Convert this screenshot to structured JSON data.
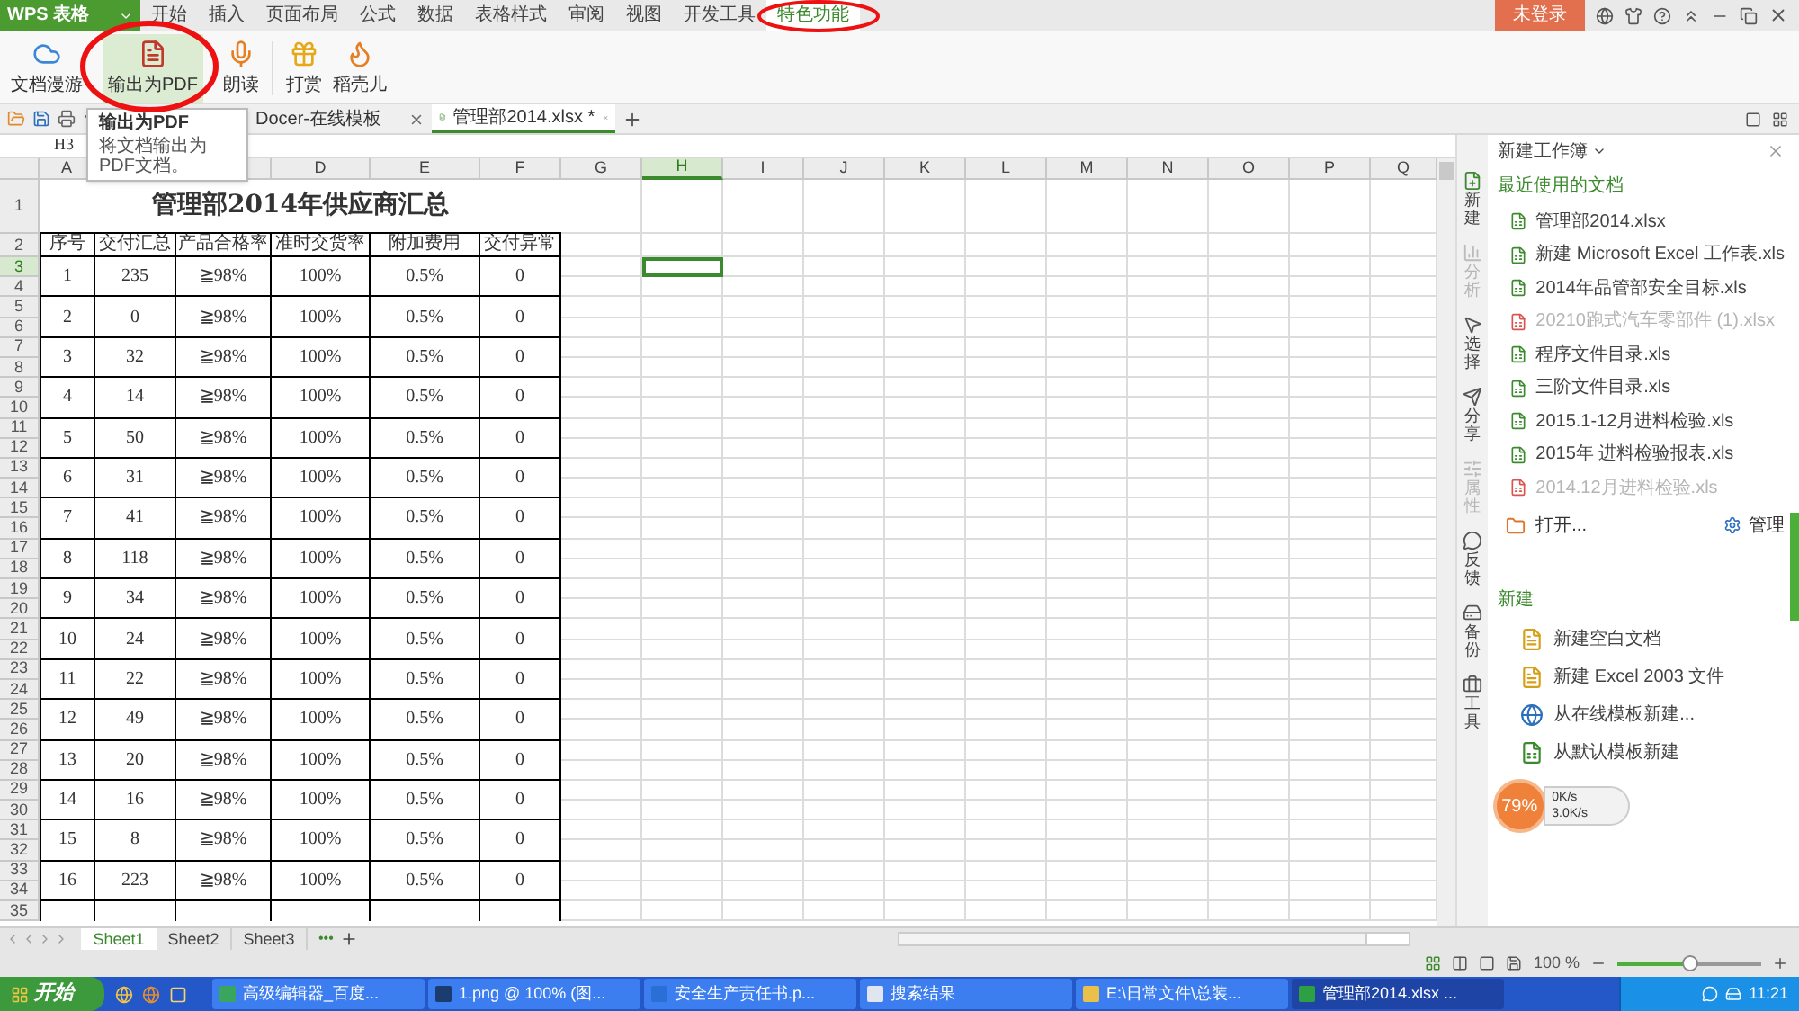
{
  "app_menu": {
    "label": "WPS 表格"
  },
  "menu_tabs": [
    {
      "label": "开始",
      "selected": false
    },
    {
      "label": "插入",
      "selected": false
    },
    {
      "label": "页面布局",
      "selected": false
    },
    {
      "label": "公式",
      "selected": false
    },
    {
      "label": "数据",
      "selected": false
    },
    {
      "label": "表格样式",
      "selected": false
    },
    {
      "label": "审阅",
      "selected": false
    },
    {
      "label": "视图",
      "selected": false
    },
    {
      "label": "开发工具",
      "selected": false
    },
    {
      "label": "特色功能",
      "selected": true
    }
  ],
  "account_button": "未登录",
  "ribbon_buttons": [
    {
      "label": "文档漫游",
      "kind": "cloud",
      "selected": false
    },
    {
      "label": "输出为PDF",
      "kind": "pdf",
      "selected": true
    },
    {
      "label": "朗读",
      "kind": "read",
      "selected": false
    },
    {
      "label": "打赏",
      "kind": "reward",
      "selected": false
    },
    {
      "label": "稻壳儿",
      "kind": "docer",
      "selected": false
    }
  ],
  "tooltip": {
    "title": "输出为PDF",
    "text": "将文档输出为PDF文档。"
  },
  "doc_tabs": [
    {
      "label": "Docer-在线模板",
      "selected": false
    },
    {
      "label": "管理部2014.xlsx *",
      "selected": true
    }
  ],
  "name_box": "H3",
  "columns": [
    {
      "label": "A",
      "selected": false
    },
    {},
    {},
    {
      "label": "D",
      "selected": false
    },
    {
      "label": "E",
      "selected": false
    },
    {
      "label": "F",
      "selected": false
    },
    {
      "label": "G",
      "selected": false
    },
    {
      "label": "H",
      "selected": true
    },
    {
      "label": "I",
      "selected": false
    },
    {
      "label": "J",
      "selected": false
    },
    {
      "label": "K",
      "selected": false
    },
    {
      "label": "L",
      "selected": false
    },
    {
      "label": "M",
      "selected": false
    },
    {
      "label": "N",
      "selected": false
    },
    {
      "label": "O",
      "selected": false
    },
    {
      "label": "P",
      "selected": false
    },
    {
      "label": "Q",
      "selected": false
    }
  ],
  "rows": [
    {
      "label": "1",
      "selected": false
    },
    {
      "label": "2",
      "selected": false
    },
    {
      "label": "3",
      "selected": true
    },
    {
      "label": "4",
      "selected": false
    },
    {
      "label": "5",
      "selected": false
    },
    {
      "label": "6",
      "selected": false
    },
    {
      "label": "7",
      "selected": false
    },
    {
      "label": "8",
      "selected": false
    },
    {
      "label": "9",
      "selected": false
    },
    {
      "label": "10",
      "selected": false
    },
    {
      "label": "11",
      "selected": false
    },
    {
      "label": "12",
      "selected": false
    },
    {
      "label": "13",
      "selected": false
    },
    {
      "label": "14",
      "selected": false
    },
    {
      "label": "15",
      "selected": false
    },
    {
      "label": "16",
      "selected": false
    },
    {
      "label": "17",
      "selected": false
    },
    {
      "label": "18",
      "selected": false
    },
    {
      "label": "19",
      "selected": false
    },
    {
      "label": "20",
      "selected": false
    },
    {
      "label": "21",
      "selected": false
    },
    {
      "label": "22",
      "selected": false
    },
    {
      "label": "23",
      "selected": false
    },
    {
      "label": "24",
      "selected": false
    },
    {
      "label": "25",
      "selected": false
    },
    {
      "label": "26",
      "selected": false
    },
    {
      "label": "27",
      "selected": false
    },
    {
      "label": "28",
      "selected": false
    },
    {
      "label": "29",
      "selected": false
    },
    {
      "label": "30",
      "selected": false
    },
    {
      "label": "31",
      "selected": false
    },
    {
      "label": "32",
      "selected": false
    },
    {
      "label": "33",
      "selected": false
    },
    {
      "label": "34",
      "selected": false
    },
    {
      "label": "35",
      "selected": false
    }
  ],
  "table": {
    "title": "管理部2014年供应商汇总",
    "columns": [
      "序号",
      "交付汇总",
      "产品合格率",
      "准时交货率",
      "附加费用",
      "交付异常"
    ],
    "rows": [
      [
        "1",
        "235",
        "≧98%",
        "100%",
        "0.5%",
        "0"
      ],
      [
        "2",
        "0",
        "≧98%",
        "100%",
        "0.5%",
        "0"
      ],
      [
        "3",
        "32",
        "≧98%",
        "100%",
        "0.5%",
        "0"
      ],
      [
        "4",
        "14",
        "≧98%",
        "100%",
        "0.5%",
        "0"
      ],
      [
        "5",
        "50",
        "≧98%",
        "100%",
        "0.5%",
        "0"
      ],
      [
        "6",
        "31",
        "≧98%",
        "100%",
        "0.5%",
        "0"
      ],
      [
        "7",
        "41",
        "≧98%",
        "100%",
        "0.5%",
        "0"
      ],
      [
        "8",
        "118",
        "≧98%",
        "100%",
        "0.5%",
        "0"
      ],
      [
        "9",
        "34",
        "≧98%",
        "100%",
        "0.5%",
        "0"
      ],
      [
        "10",
        "24",
        "≧98%",
        "100%",
        "0.5%",
        "0"
      ],
      [
        "11",
        "22",
        "≧98%",
        "100%",
        "0.5%",
        "0"
      ],
      [
        "12",
        "49",
        "≧98%",
        "100%",
        "0.5%",
        "0"
      ],
      [
        "13",
        "20",
        "≧98%",
        "100%",
        "0.5%",
        "0"
      ],
      [
        "14",
        "16",
        "≧98%",
        "100%",
        "0.5%",
        "0"
      ],
      [
        "15",
        "8",
        "≧98%",
        "100%",
        "0.5%",
        "0"
      ],
      [
        "16",
        "223",
        "≧98%",
        "100%",
        "0.5%",
        "0"
      ]
    ]
  },
  "sheet_tabs": [
    {
      "label": "Sheet1",
      "selected": true
    },
    {
      "label": "Sheet2",
      "selected": false
    },
    {
      "label": "Sheet3",
      "selected": false
    }
  ],
  "more_sheets": "•••",
  "status_bar": {
    "zoom": "100 %",
    "zoom_slider": {
      "level": 0.5
    }
  },
  "side_tools": [
    {
      "label": "新建",
      "kind": "new",
      "disabled": false
    },
    {
      "label": "分析",
      "kind": "analyze",
      "disabled": true
    },
    {
      "label": "选择",
      "kind": "select",
      "disabled": false
    },
    {
      "label": "分享",
      "kind": "share",
      "disabled": false
    },
    {
      "label": "属性",
      "kind": "props",
      "disabled": true
    },
    {
      "label": "反馈",
      "kind": "feedback",
      "disabled": false
    },
    {
      "label": "备份",
      "kind": "backup",
      "disabled": false
    },
    {
      "label": "工具",
      "kind": "tools",
      "disabled": false
    }
  ],
  "side_panel": {
    "title": "新建工作簿",
    "recent_heading": "最近使用的文档",
    "recent": [
      {
        "name": "管理部2014.xlsx",
        "missing": false
      },
      {
        "name": "新建 Microsoft Excel 工作表.xls",
        "missing": false
      },
      {
        "name": "2014年品管部安全目标.xls",
        "missing": false
      },
      {
        "name": "20210跑式汽车零部件 (1).xlsx",
        "missing": true
      },
      {
        "name": "程序文件目录.xls",
        "missing": false
      },
      {
        "name": "三阶文件目录.xls",
        "missing": false
      },
      {
        "name": "2015.1-12月进料检验.xls",
        "missing": false
      },
      {
        "name": "2015年 进料检验报表.xls",
        "missing": false
      },
      {
        "name": "2014.12月进料检验.xls",
        "missing": true
      }
    ],
    "open": "打开...",
    "manage": "管理",
    "new_heading": "新建",
    "new_items": [
      {
        "label": "新建空白文档",
        "kind": "blank"
      },
      {
        "label": "新建 Excel 2003 文件",
        "kind": "blank"
      },
      {
        "label": "从在线模板新建...",
        "kind": "online"
      },
      {
        "label": "从默认模板新建",
        "kind": "template"
      }
    ]
  },
  "speed_widget": {
    "percent": "79%",
    "up": "0K/s",
    "down": "3.0K/s"
  },
  "taskbar": {
    "start": "开始",
    "tasks": [
      {
        "label": "高级编辑器_百度...",
        "kind": "browser",
        "selected": false
      },
      {
        "label": "1.png @ 100% (图...",
        "kind": "ps",
        "selected": false
      },
      {
        "label": "安全生产责任书.p...",
        "kind": "word",
        "selected": false
      },
      {
        "label": "搜索结果",
        "kind": "doc",
        "selected": false
      },
      {
        "label": "E:\\日常文件\\总装...",
        "kind": "folder",
        "selected": false
      },
      {
        "label": "管理部2014.xlsx ...",
        "kind": "wps",
        "selected": true
      }
    ],
    "clock": "11:21"
  }
}
